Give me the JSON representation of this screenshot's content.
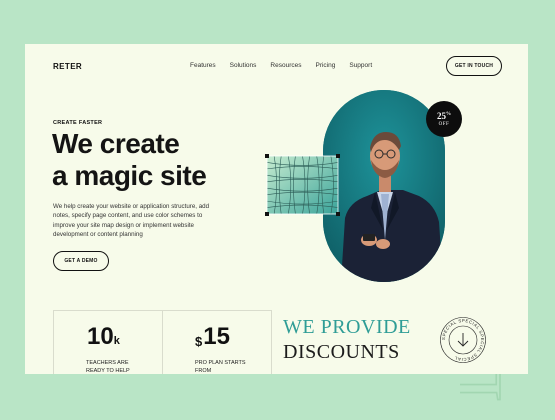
{
  "header": {
    "logo": "RETER",
    "nav": [
      "Features",
      "Solutions",
      "Resources",
      "Pricing",
      "Support"
    ],
    "cta": "GET IN TOUCH"
  },
  "hero": {
    "eyebrow": "CREATE FASTER",
    "headline_line1": "We create",
    "headline_line2": "a magic site",
    "description": "We help create your website or application structure, add notes, specify page content, and use color schemes to improve your site map design or implement website development or content planning",
    "cta": "GET A DEMO"
  },
  "badge": {
    "value": "25",
    "unit": "%",
    "label": "OFF"
  },
  "stats": [
    {
      "prefix": "",
      "number": "10",
      "suffix": "k",
      "label": "TEACHERS ARE READY TO HELP"
    },
    {
      "prefix": "$",
      "number": "15",
      "suffix": "",
      "label": "PRO PLAN STARTS FROM"
    }
  ],
  "discount": {
    "line1": "WE PROVIDE",
    "line2": "DISCOUNTS"
  },
  "seal_text": "SPECIAL SPECIAL SPECIAL SPECIAL",
  "background_word": "Design",
  "colors": {
    "page_bg": "#b9e5c6",
    "card_bg": "#f7fbea",
    "accent_teal": "#157a80",
    "discount_teal": "#2f9d96"
  }
}
